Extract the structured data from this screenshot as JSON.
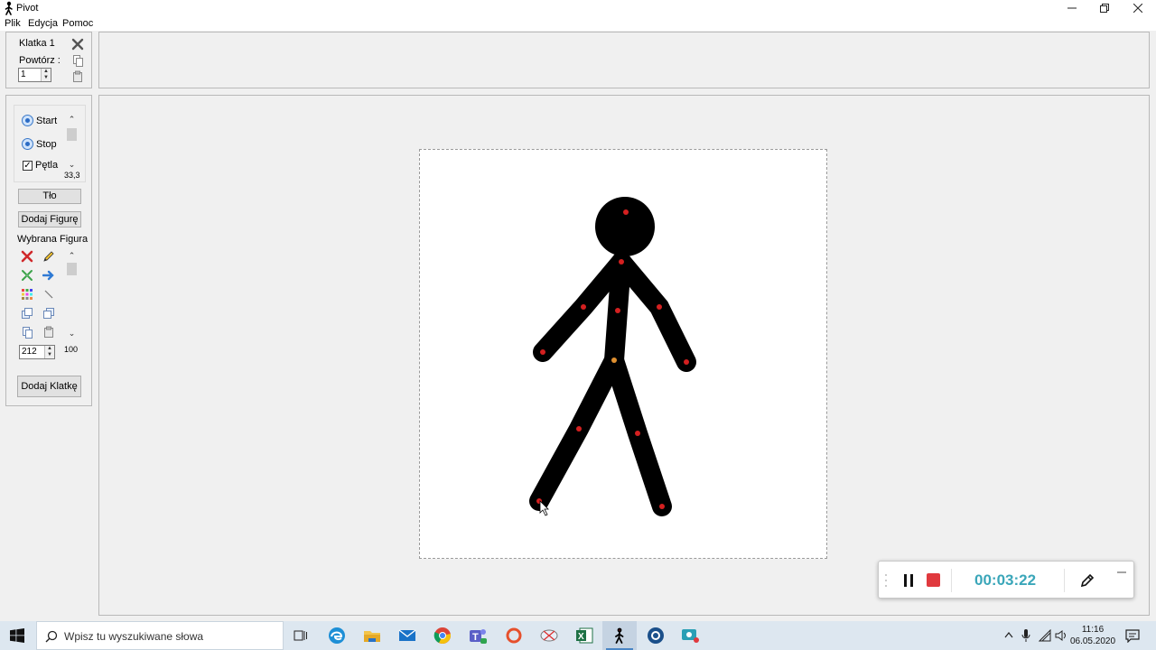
{
  "window": {
    "title": "Pivot",
    "minimize": "—",
    "restore": "❐",
    "close": "✕"
  },
  "menu": [
    "Plik",
    "Edycja",
    "Pomoc"
  ],
  "frame_panel": {
    "frame_label": "Klatka 1",
    "repeat_label": "Powtórz :",
    "repeat_value": "1"
  },
  "playback": {
    "start_label": "Start",
    "stop_label": "Stop",
    "loop_label": "Pętla",
    "loop_checked": true,
    "speed_value": "33,3"
  },
  "buttons": {
    "background": "Tło",
    "add_figure": "Dodaj Figurę",
    "add_frame": "Dodaj Klatkę"
  },
  "figure": {
    "section_label": "Wybrana Figura",
    "size_value": "212",
    "alpha_value": "100"
  },
  "recorder": {
    "elapsed": "00:03:22",
    "timer_color": "#3aa6b9",
    "stop_color": "#e0393e"
  },
  "taskbar": {
    "search_placeholder": "Wpisz tu wyszukiwane słowa",
    "time": "11:16",
    "date": "06.05.2020"
  },
  "colors": {
    "stick_figure": "#000000",
    "joint_handle": "#d42020",
    "origin_handle": "#e09030"
  }
}
